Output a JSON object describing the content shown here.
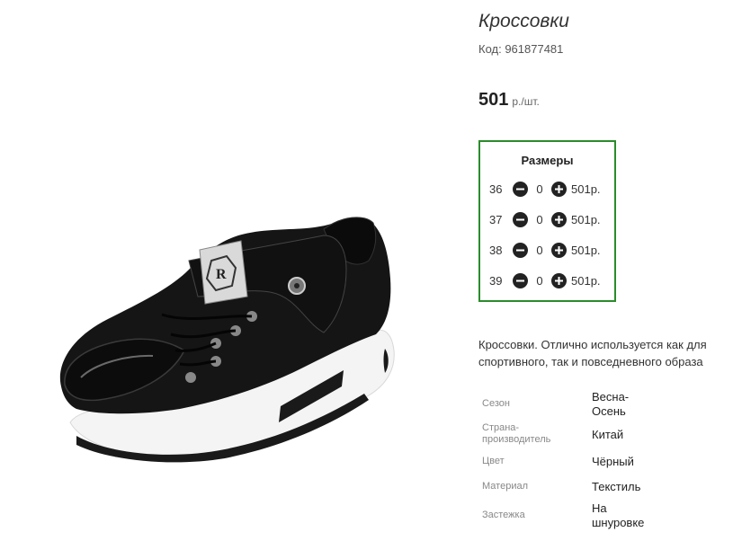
{
  "product": {
    "title": "Кроссовки",
    "code": "Код: 961877481",
    "price": "501",
    "price_unit": "р./шт."
  },
  "sizes": {
    "title": "Размеры",
    "rows": [
      {
        "size": "36",
        "qty": "0",
        "price": "501р."
      },
      {
        "size": "37",
        "qty": "0",
        "price": "501р."
      },
      {
        "size": "38",
        "qty": "0",
        "price": "501р."
      },
      {
        "size": "39",
        "qty": "0",
        "price": "501р."
      }
    ]
  },
  "description": "Кроссовки. Отлично используется как для спортивного, так и повседневного образа",
  "attributes": [
    {
      "label": "Сезон",
      "value": "Весна-Осень"
    },
    {
      "label": "Страна-производитель",
      "value": "Китай"
    },
    {
      "label": "Цвет",
      "value": "Чёрный"
    },
    {
      "label": "Материал",
      "value": "Текстиль"
    },
    {
      "label": "Застежка",
      "value": "На шнуровке"
    }
  ],
  "icons": {
    "minus": "minus-icon",
    "plus": "plus-icon"
  },
  "colors": {
    "sizes_border": "#2a8c2a",
    "button_fill": "#222222"
  }
}
